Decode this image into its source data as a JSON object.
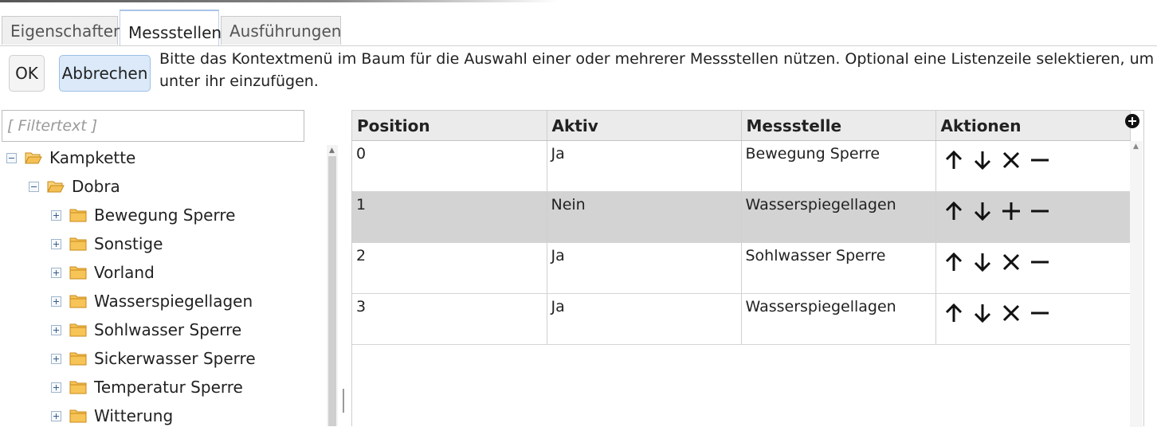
{
  "tabs": [
    {
      "label": "Eigenschaften"
    },
    {
      "label": "Messstellen"
    },
    {
      "label": "Ausführungen"
    }
  ],
  "buttons": {
    "ok": "OK",
    "cancel": "Abbrechen"
  },
  "hint": "Bitte das Kontextmenü im Baum für die Auswahl einer oder mehrerer Messstellen nützen. Optional eine Listenzeile selektieren, um unter ihr einzufügen.",
  "filter": {
    "placeholder": "[ Filtertext ]"
  },
  "tree": {
    "root": "Kampkette",
    "child": "Dobra",
    "items": [
      "Bewegung Sperre",
      "Sonstige",
      "Vorland",
      "Wasserspiegellagen",
      "Sohlwasser Sperre",
      "Sickerwasser Sperre",
      "Temperatur Sperre",
      "Witterung"
    ]
  },
  "table": {
    "headers": [
      "Position",
      "Aktiv",
      "Messstelle",
      "Aktionen"
    ],
    "rows": [
      {
        "position": "0",
        "aktiv": "Ja",
        "messstelle": "Bewegung Sperre",
        "toggle": "deactivate"
      },
      {
        "position": "1",
        "aktiv": "Nein",
        "messstelle": "Wasserspiegellagen",
        "toggle": "activate"
      },
      {
        "position": "2",
        "aktiv": "Ja",
        "messstelle": "Sohlwasser Sperre",
        "toggle": "deactivate"
      },
      {
        "position": "3",
        "aktiv": "Ja",
        "messstelle": "Wasserspiegellagen",
        "toggle": "deactivate"
      }
    ],
    "selected_row": 1
  },
  "icons": {
    "row_actions": [
      "arrow-up-icon",
      "arrow-down-icon",
      "toggle-icon",
      "remove-icon"
    ],
    "add": "add-circle-icon"
  },
  "colors": {
    "selected_row": "#d3d3d3",
    "primary_button": "#dbe9f9",
    "folder": "#f0b43c"
  }
}
